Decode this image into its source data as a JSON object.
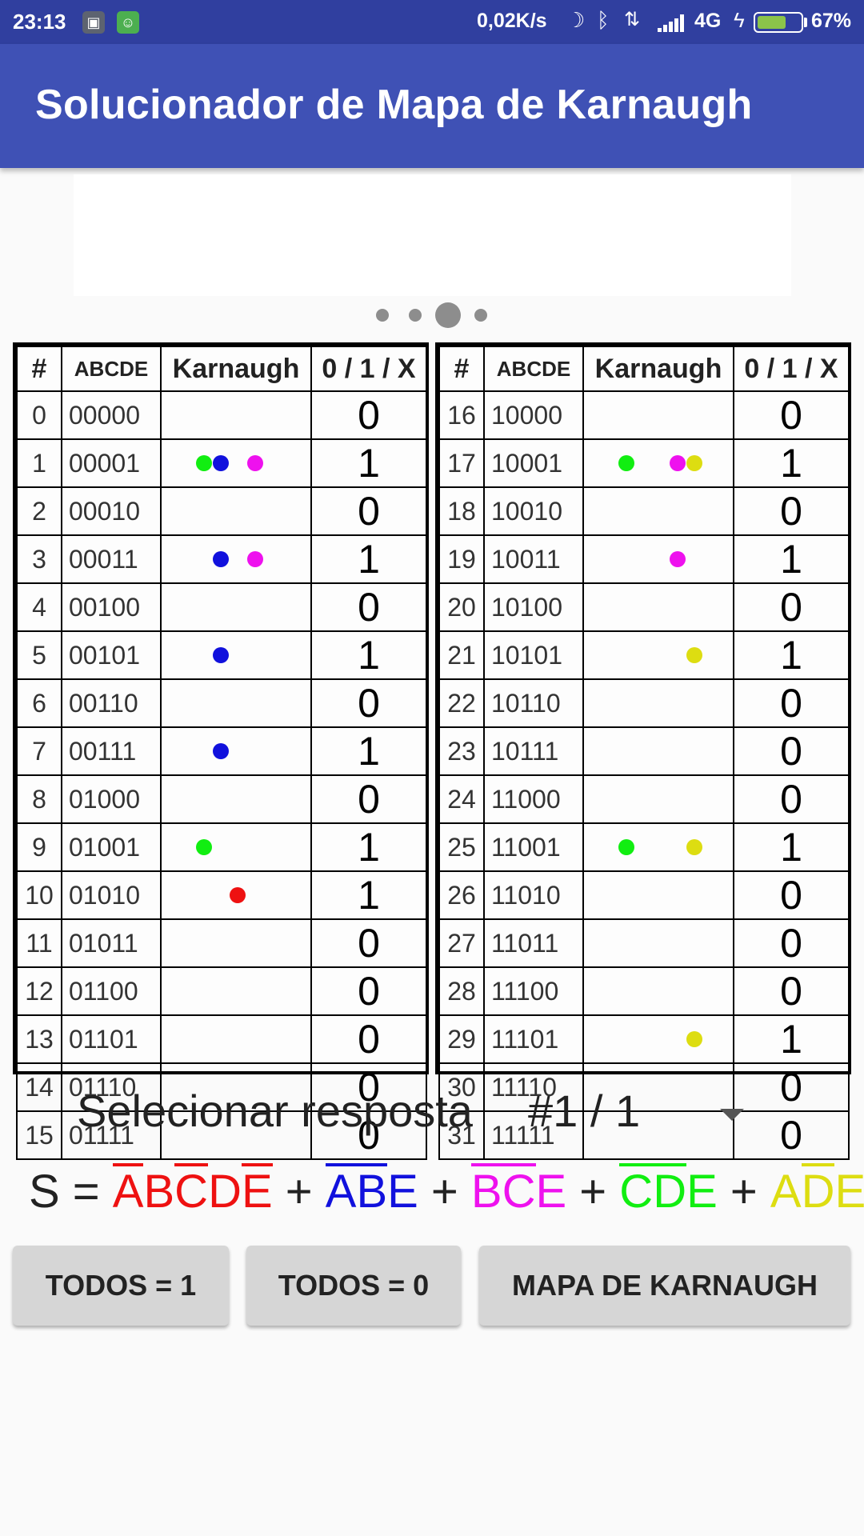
{
  "status_bar": {
    "time": "23:13",
    "speed": "0,02K/s",
    "network": "4G",
    "battery_pct": "67%",
    "battery_level": 0.67,
    "icons": [
      "screenshot-app-icon",
      "android-app-icon",
      "moon-icon",
      "bluetooth-icon",
      "data-transfer-icon",
      "signal-icon",
      "charging-icon",
      "battery-icon"
    ]
  },
  "app_bar": {
    "title": "Solucionador de Mapa de Karnaugh"
  },
  "pager": {
    "count": 4,
    "active_index": 2
  },
  "colors": {
    "red": "#ee1111",
    "blue": "#1111dd",
    "magenta": "#ee11ee",
    "green": "#11ee11",
    "yellow": "#dddd11",
    "app_bar": "#3f51b5",
    "status_bar": "#303f9f"
  },
  "table": {
    "headers": [
      "#",
      "ABCDE",
      "Karnaugh",
      "0 / 1 / X"
    ],
    "rows": [
      {
        "n": "0",
        "bin": "00000",
        "val": "0",
        "dots": []
      },
      {
        "n": "1",
        "bin": "00001",
        "val": "1",
        "dots": [
          "green",
          "blue",
          "magenta"
        ]
      },
      {
        "n": "2",
        "bin": "00010",
        "val": "0",
        "dots": []
      },
      {
        "n": "3",
        "bin": "00011",
        "val": "1",
        "dots": [
          "blue",
          "magenta"
        ]
      },
      {
        "n": "4",
        "bin": "00100",
        "val": "0",
        "dots": []
      },
      {
        "n": "5",
        "bin": "00101",
        "val": "1",
        "dots": [
          "blue"
        ]
      },
      {
        "n": "6",
        "bin": "00110",
        "val": "0",
        "dots": []
      },
      {
        "n": "7",
        "bin": "00111",
        "val": "1",
        "dots": [
          "blue"
        ]
      },
      {
        "n": "8",
        "bin": "01000",
        "val": "0",
        "dots": []
      },
      {
        "n": "9",
        "bin": "01001",
        "val": "1",
        "dots": [
          "green"
        ]
      },
      {
        "n": "10",
        "bin": "01010",
        "val": "1",
        "dots": [
          "red"
        ]
      },
      {
        "n": "11",
        "bin": "01011",
        "val": "0",
        "dots": []
      },
      {
        "n": "12",
        "bin": "01100",
        "val": "0",
        "dots": []
      },
      {
        "n": "13",
        "bin": "01101",
        "val": "0",
        "dots": []
      },
      {
        "n": "14",
        "bin": "01110",
        "val": "0",
        "dots": []
      },
      {
        "n": "15",
        "bin": "01111",
        "val": "0",
        "dots": []
      },
      {
        "n": "16",
        "bin": "10000",
        "val": "0",
        "dots": []
      },
      {
        "n": "17",
        "bin": "10001",
        "val": "1",
        "dots": [
          "green",
          "magenta",
          "yellow"
        ]
      },
      {
        "n": "18",
        "bin": "10010",
        "val": "0",
        "dots": []
      },
      {
        "n": "19",
        "bin": "10011",
        "val": "1",
        "dots": [
          "magenta"
        ]
      },
      {
        "n": "20",
        "bin": "10100",
        "val": "0",
        "dots": []
      },
      {
        "n": "21",
        "bin": "10101",
        "val": "1",
        "dots": [
          "yellow"
        ]
      },
      {
        "n": "22",
        "bin": "10110",
        "val": "0",
        "dots": []
      },
      {
        "n": "23",
        "bin": "10111",
        "val": "0",
        "dots": []
      },
      {
        "n": "24",
        "bin": "11000",
        "val": "0",
        "dots": []
      },
      {
        "n": "25",
        "bin": "11001",
        "val": "1",
        "dots": [
          "green",
          "yellow"
        ]
      },
      {
        "n": "26",
        "bin": "11010",
        "val": "0",
        "dots": []
      },
      {
        "n": "27",
        "bin": "11011",
        "val": "0",
        "dots": []
      },
      {
        "n": "28",
        "bin": "11100",
        "val": "0",
        "dots": []
      },
      {
        "n": "29",
        "bin": "11101",
        "val": "1",
        "dots": [
          "yellow"
        ]
      },
      {
        "n": "30",
        "bin": "11110",
        "val": "0",
        "dots": []
      },
      {
        "n": "31",
        "bin": "11111",
        "val": "0",
        "dots": []
      }
    ]
  },
  "selector": {
    "label": "Selecionar resposta",
    "value": "#1 / 1"
  },
  "expression": {
    "prefix": "S =",
    "terms": [
      {
        "color": "red",
        "literals": [
          {
            "ch": "A",
            "neg": true
          },
          {
            "ch": "B",
            "neg": false
          },
          {
            "ch": "C",
            "neg": true
          },
          {
            "ch": "D",
            "neg": false
          },
          {
            "ch": "E",
            "neg": true
          }
        ]
      },
      {
        "color": "blue",
        "literals": [
          {
            "ch": "A",
            "neg": true
          },
          {
            "ch": "B",
            "neg": true
          },
          {
            "ch": "E",
            "neg": false
          }
        ]
      },
      {
        "color": "magenta",
        "literals": [
          {
            "ch": "B",
            "neg": true
          },
          {
            "ch": "C",
            "neg": true
          },
          {
            "ch": "E",
            "neg": false
          }
        ]
      },
      {
        "color": "green",
        "literals": [
          {
            "ch": "C",
            "neg": true
          },
          {
            "ch": "D",
            "neg": true
          },
          {
            "ch": "E",
            "neg": false
          }
        ]
      },
      {
        "color": "yellow",
        "literals": [
          {
            "ch": "A",
            "neg": false
          },
          {
            "ch": "D",
            "neg": true
          },
          {
            "ch": "E",
            "neg": false
          }
        ]
      }
    ],
    "operator": "+"
  },
  "buttons": {
    "all_ones": "TODOS = 1",
    "all_zeros": "TODOS = 0",
    "karnaugh_map": "MAPA DE KARNAUGH"
  }
}
